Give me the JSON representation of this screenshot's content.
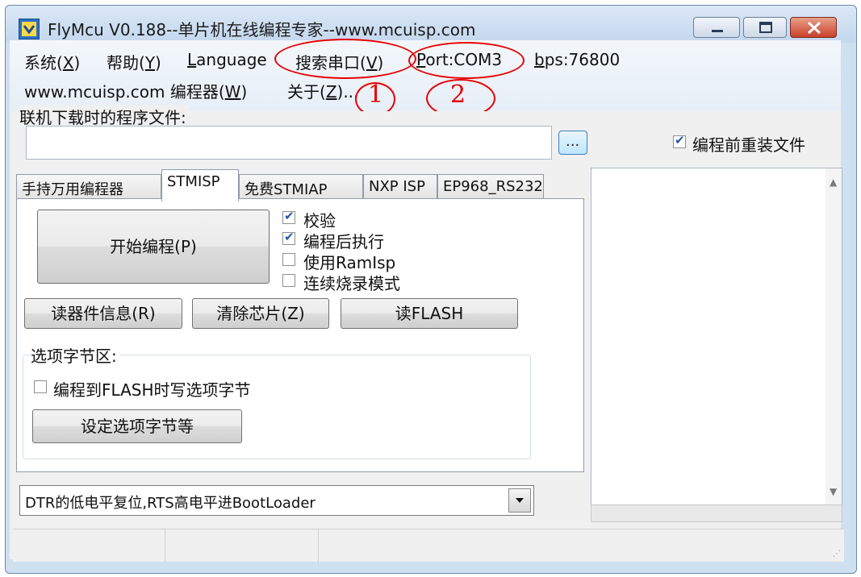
{
  "window": {
    "title": "FlyMcu V0.188--单片机在线编程专家--www.mcuisp.com"
  },
  "menu": {
    "row1": [
      {
        "text": "系统(",
        "key": "X",
        "suffix": ")"
      },
      {
        "text": "帮助(",
        "key": "Y",
        "suffix": ")"
      },
      {
        "text": "",
        "key": "L",
        "suffix": "anguage"
      },
      {
        "text": "搜索串口(",
        "key": "V",
        "suffix": ")"
      },
      {
        "text": "",
        "key": "P",
        "suffix": "ort:COM3"
      },
      {
        "text": "",
        "key": "b",
        "suffix": "ps:76800"
      }
    ],
    "row2": [
      {
        "text": "www.mcuisp.com 编程器(",
        "key": "W",
        "suffix": ")"
      },
      {
        "text": "关于(",
        "key": "Z",
        "suffix": ")..."
      }
    ]
  },
  "annotations": {
    "mark1": "1",
    "mark2": "2",
    "color": "#e60000"
  },
  "file_section": {
    "label": "联机下载时的程序文件:",
    "value": "",
    "browse_label": "...",
    "reload_label": "编程前重装文件",
    "reload_checked": true
  },
  "tabs": [
    {
      "label": "手持万用编程器",
      "active": false
    },
    {
      "label": "STMISP",
      "active": true
    },
    {
      "label": "免费STMIAP",
      "active": false
    },
    {
      "label": "NXP ISP",
      "active": false
    },
    {
      "label": "EP968_RS232",
      "active": false
    }
  ],
  "stmisp": {
    "start_button": "开始编程(P)",
    "options": [
      {
        "label": "校验",
        "checked": true
      },
      {
        "label": "编程后执行",
        "checked": true
      },
      {
        "label": "使用RamIsp",
        "checked": false
      },
      {
        "label": "连续烧录模式",
        "checked": false
      }
    ],
    "read_info_button": "读器件信息(R)",
    "erase_button": "清除芯片(Z)",
    "read_flash_button": "读FLASH",
    "option_bytes_title": "选项字节区:",
    "write_option_label": "编程到FLASH时写选项字节",
    "write_option_checked": false,
    "set_option_button": "设定选项字节等"
  },
  "reset_mode": {
    "selected": "DTR的低电平复位,RTS高电平进BootLoader"
  },
  "icons": {
    "app": "flymcu-app-icon",
    "minimize": "minimize-icon",
    "maximize": "maximize-icon",
    "close": "close-icon"
  }
}
